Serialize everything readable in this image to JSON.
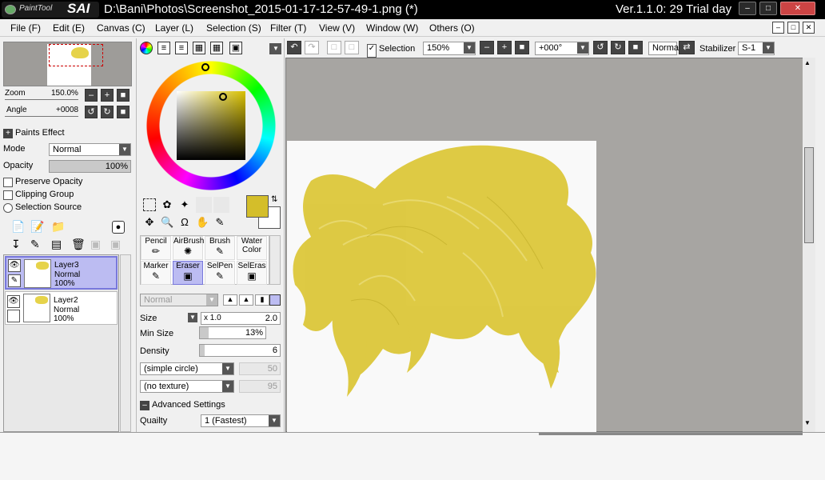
{
  "window": {
    "logo_text": "PaintTool",
    "logo_brand": "SAI",
    "title": "D:\\Bani\\Photos\\Screenshot_2015-01-17-12-57-49-1.png (*)",
    "version": "Ver.1.1.0: 29 Trial day"
  },
  "menu": [
    "File (F)",
    "Edit (E)",
    "Canvas (C)",
    "Layer (L)",
    "Selection (S)",
    "Filter (T)",
    "View (V)",
    "Window (W)",
    "Others (O)"
  ],
  "navigator": {
    "zoom_label": "Zoom",
    "zoom_value": "150.0%",
    "angle_label": "Angle",
    "angle_value": "+0008"
  },
  "layer_props": {
    "paints_effect": "Paints Effect",
    "mode_label": "Mode",
    "mode_value": "Normal",
    "opacity_label": "Opacity",
    "opacity_value": "100%",
    "preserve_opacity": "Preserve Opacity",
    "clipping_group": "Clipping Group",
    "selection_source": "Selection Source"
  },
  "layers": [
    {
      "name": "Layer3",
      "mode": "Normal",
      "opacity": "100%",
      "selected": true
    },
    {
      "name": "Layer2",
      "mode": "Normal",
      "opacity": "100%",
      "selected": false
    }
  ],
  "tools": [
    {
      "label": "Pencil",
      "label2": ""
    },
    {
      "label": "AirBrush",
      "label2": ""
    },
    {
      "label": "Brush",
      "label2": ""
    },
    {
      "label": "Water",
      "label2": "Color"
    },
    {
      "label": "Marker",
      "label2": ""
    },
    {
      "label": "Eraser",
      "label2": ""
    },
    {
      "label": "SelPen",
      "label2": ""
    },
    {
      "label": "SelEras",
      "label2": ""
    }
  ],
  "brush": {
    "blend_mode": "Normal",
    "size_label": "Size",
    "size_mult": "x 1.0",
    "size_value": "2.0",
    "min_size_label": "Min Size",
    "min_size_value": "13%",
    "min_size_fraction": 0.13,
    "density_label": "Density",
    "density_value": "6",
    "density_fraction": 0.06,
    "shape": "(simple circle)",
    "shape_value": "50",
    "texture": "(no texture)",
    "texture_value": "95",
    "advanced": "Advanced Settings",
    "quality_label": "Quailty",
    "quality_value": "1 (Fastest)"
  },
  "colors": {
    "primary": "#d4be2a",
    "secondary": "#ffffff",
    "hair": "#dcc73a",
    "selection_bg": "#bcbcf2"
  },
  "toolbar": {
    "selection_label": "Selection",
    "selection_checked": true,
    "zoom": "150%",
    "angle": "+000°",
    "blend": "Normal",
    "stabilizer_label": "Stabilizer",
    "stabilizer_value": "S-1"
  }
}
